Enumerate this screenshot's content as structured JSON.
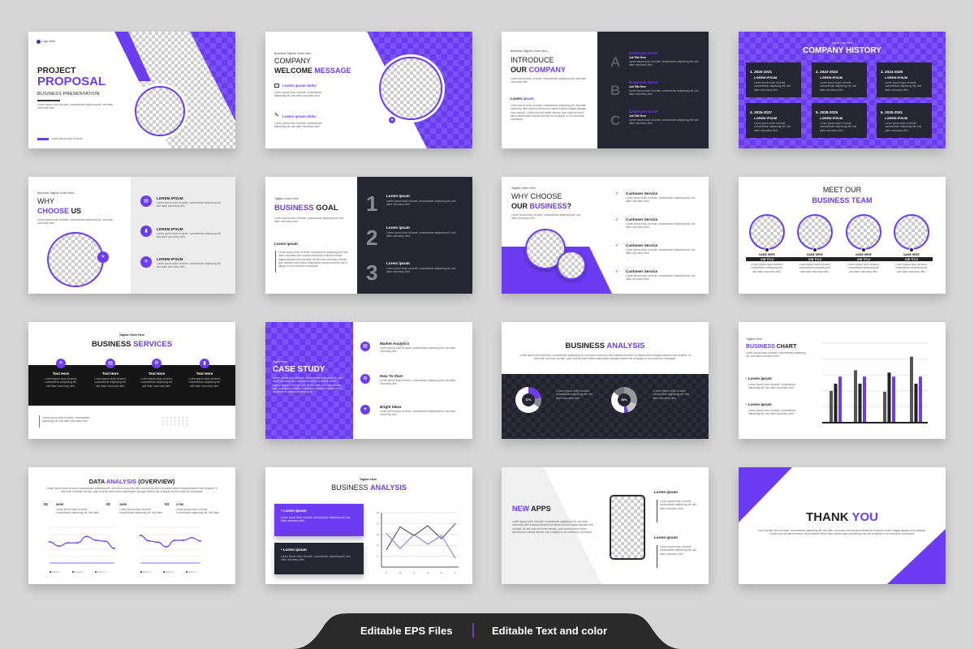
{
  "colors": {
    "accent": "#6c3cf2",
    "dark": "#252631",
    "background": "#d6d6d6"
  },
  "lorem": {
    "a": "Lorem ipsum dolor sit amet, consectetuer adipiscing elit, sed diam nonummy nibh.",
    "b": "Lorem ipsum dolor sit amet, consectetuer adipiscing elit, sed diam nonummy nibh euismod tincidunt ut laoreet dolore magna aliquam erat volutpat. Ut wisi enim ad minim veniam, quis nostrud exerci tation ullamcorper suscipit lobortis nisl ut aliquip ex ea commodo consequat."
  },
  "s1": {
    "logo": "Logo Here",
    "title1": "PROJECT",
    "title2": "PROPOSAL",
    "subtitle": "BUSINESS PRESENTATION",
    "footer": "Lorem ipsum dolor sit amet"
  },
  "s2": {
    "tagline": "Business Tagline Goes Here_",
    "title1": "COMPANY",
    "title2a": "WELCOME ",
    "title2b": "MESSAGE",
    "item1": "Lorem ipsum dolor",
    "item2": "Lorem ipsum dolor"
  },
  "s3": {
    "tagline": "Business Tagline Goes Here_",
    "title1": "INTRODUCE",
    "title2a": "OUR ",
    "title2b": "COMPANY",
    "heading_a": "Lorem ",
    "heading_b": "ipsum",
    "people": [
      {
        "letter": "A",
        "name": "Employee Name",
        "job": "Job Title Here"
      },
      {
        "letter": "B",
        "name": "Employee Name",
        "job": "Job Title Here"
      },
      {
        "letter": "C",
        "name": "Employee Name",
        "job": "Job Title Here"
      }
    ]
  },
  "s4": {
    "tagline": "Tagline Goes Here",
    "title": "COMPANY HISTORY",
    "items": [
      {
        "period": "1. 2020-2021",
        "label": "LOREM IPSUM"
      },
      {
        "period": "2. 2022-2023",
        "label": "LOREM IPSUM"
      },
      {
        "period": "3. 2024-2025",
        "label": "LOREM IPSUM"
      },
      {
        "period": "4. 2026-2027",
        "label": "LOREM IPSUM"
      },
      {
        "period": "5. 2028-2029",
        "label": "LOREM IPSUM"
      },
      {
        "period": "6. 2030-2031",
        "label": "LOREM IPSUM"
      }
    ]
  },
  "s5": {
    "tagline": "Business Tagline Goes Here_",
    "title1": "WHY",
    "title2a": "CHOOSE ",
    "title2b": "US",
    "items": [
      "LOREM IPSUM",
      "LOREM IPSUM",
      "LOREM IPSUM"
    ]
  },
  "s6": {
    "tagline": "Tagline Goes Here",
    "title_a": "BUSINESS ",
    "title_b": "GOAL",
    "heading": "Lorem ipsum",
    "steps": [
      {
        "num": "1",
        "title": "Lorem ipsum"
      },
      {
        "num": "2",
        "title": "Lorem ipsum"
      },
      {
        "num": "3",
        "title": "Lorem ipsum"
      }
    ]
  },
  "s7": {
    "tagline": "Tagline Goes Here",
    "title1": "WHY CHOOSE",
    "title2a": "OUR ",
    "title2b": "BUSINESS",
    "title2c": "?",
    "items": [
      "Customer Service",
      "Customer Service",
      "Customer Service",
      "Customer Service"
    ]
  },
  "s8": {
    "title1": "MEET OUR",
    "title2": "BUSINESS TEAM",
    "members": [
      {
        "name": "NAME HERE",
        "job": "JOB TITLE"
      },
      {
        "name": "NAME HERE",
        "job": "JOB TITLE"
      },
      {
        "name": "NAME HERE",
        "job": "JOB TITLE"
      },
      {
        "name": "NAME HERE",
        "job": "JOB TITLE"
      }
    ]
  },
  "s9": {
    "tagline": "Tagline Goes Here",
    "title_a": "BUSINESS ",
    "title_b": "SERVICES",
    "items": [
      "Text Here",
      "Text Here",
      "Text Here",
      "Text Here"
    ]
  },
  "s10": {
    "tagline": "Tagline Here",
    "title": "CASE STUDY",
    "items": [
      "Market Analytics",
      "How To Start",
      "Bright Ideas"
    ]
  },
  "s11": {
    "title_a": "BUSINESS ",
    "title_b": "ANALYSIS",
    "donuts": [
      {
        "label": "47%"
      },
      {
        "label": "85%"
      }
    ]
  },
  "s12": {
    "tagline": "Tagline Here",
    "title_a": "BUSINESS ",
    "title_b": "CHART",
    "bullets": [
      "Lorem ipsum",
      "Lorem ipsum"
    ],
    "chart_data": {
      "type": "bar",
      "categories": [
        "1",
        "2",
        "3",
        "4"
      ],
      "ylim": [
        0,
        100
      ],
      "grid": true,
      "series": [
        {
          "color": "#555555",
          "values": [
            40,
            66,
            39,
            83
          ]
        },
        {
          "color": "#222222",
          "values": [
            49,
            49,
            63,
            49
          ]
        },
        {
          "color": "#6c3cf2",
          "values": [
            58,
            58,
            58,
            58
          ]
        }
      ]
    }
  },
  "s13": {
    "title_a": "DATA ",
    "title_b": "ANALYSIS",
    "title_c": " (OVERVIEW)",
    "stats": [
      {
        "idx": "01",
        "value": "3005"
      },
      {
        "idx": "02",
        "value": "1905"
      },
      {
        "idx": "03",
        "value": "2795"
      }
    ],
    "legend": [
      "Series 1",
      "Series 2",
      "Series 3"
    ],
    "chart_data": [
      {
        "type": "line",
        "values": [
          55,
          42,
          52,
          52,
          72,
          60,
          57,
          35
        ]
      },
      {
        "type": "line",
        "values": [
          75,
          58,
          54,
          40,
          60,
          60,
          68,
          58
        ]
      }
    ]
  },
  "s14": {
    "tagline": "Tagline Here_",
    "title_a": "BUSINESS ",
    "title_b": "ANALYSIS",
    "boxes": [
      "Lorem ipsum",
      "Lorem ipsum"
    ],
    "chart_data": {
      "type": "line",
      "categories": [
        "A",
        "B",
        "C",
        "D",
        "E",
        "F"
      ],
      "yticks": [
        "10",
        "20",
        "30",
        "40",
        "50"
      ],
      "ylim": [
        0,
        50
      ],
      "series": [
        {
          "color": "#444444",
          "values": [
            16,
            37,
            29,
            38,
            26,
            40
          ]
        },
        {
          "color": "#8b6cf0",
          "values": [
            31,
            17,
            30,
            21,
            29,
            8
          ]
        }
      ]
    }
  },
  "s15": {
    "title_a": "NEW ",
    "title_b": "APPS",
    "items": [
      "Lorem ipsum",
      "Lorem ipsum"
    ]
  },
  "s16": {
    "title_a": "THANK ",
    "title_b": "YOU"
  },
  "banner": {
    "left": "Editable EPS Files",
    "right": "Editable Text and color"
  }
}
